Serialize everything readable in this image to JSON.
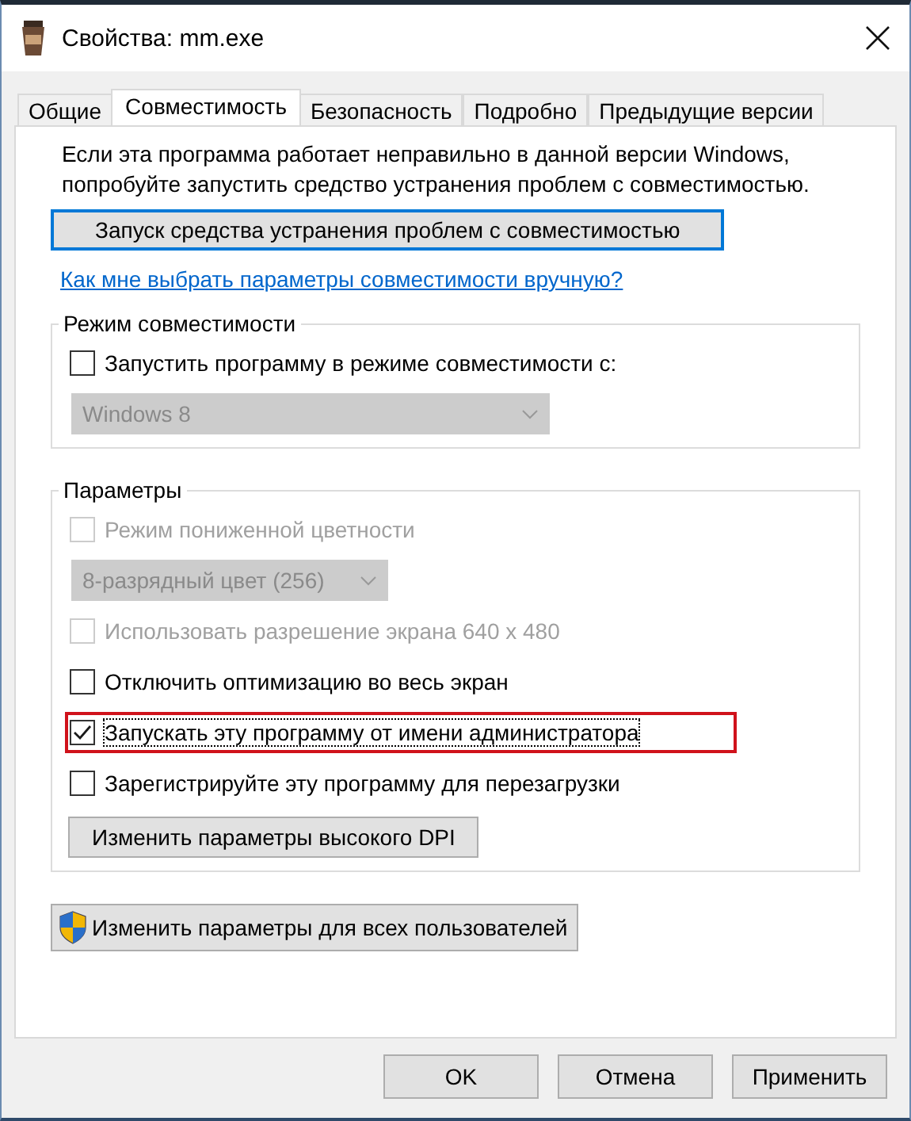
{
  "window": {
    "title": "Свойства: mm.exe"
  },
  "tabs": [
    {
      "label": "Общие",
      "selected": false
    },
    {
      "label": "Совместимость",
      "selected": true
    },
    {
      "label": "Безопасность",
      "selected": false
    },
    {
      "label": "Подробно",
      "selected": false
    },
    {
      "label": "Предыдущие версии",
      "selected": false
    }
  ],
  "intro": "Если эта программа работает неправильно в данной версии Windows, попробуйте запустить средство устранения проблем с совместимостью.",
  "troubleshoot_button": "Запуск средства устранения проблем с совместимостью",
  "help_link": "Как мне выбрать параметры совместимости вручную?",
  "groups": [
    {
      "title": "Режим совместимости",
      "items": [
        {
          "kind": "checkbox",
          "label": "Запустить программу в режиме совместимости с:",
          "checked": false,
          "disabled": false,
          "highlighted": false
        },
        {
          "kind": "dropdown",
          "value": "Windows 8",
          "disabled": true
        }
      ]
    },
    {
      "title": "Параметры",
      "items": [
        {
          "kind": "checkbox",
          "label": "Режим пониженной цветности",
          "checked": false,
          "disabled": true,
          "highlighted": false
        },
        {
          "kind": "dropdown",
          "value": "8-разрядный цвет (256)",
          "disabled": true
        },
        {
          "kind": "checkbox",
          "label": "Использовать разрешение экрана 640 x 480",
          "checked": false,
          "disabled": true,
          "highlighted": false
        },
        {
          "kind": "checkbox",
          "label": "Отключить оптимизацию во весь экран",
          "checked": false,
          "disabled": false,
          "highlighted": false
        },
        {
          "kind": "checkbox",
          "label": "Запускать эту программу от имени администратора",
          "checked": true,
          "disabled": false,
          "highlighted": true
        },
        {
          "kind": "checkbox",
          "label": "Зарегистрируйте эту программу для перезагрузки",
          "checked": false,
          "disabled": false,
          "highlighted": false
        },
        {
          "kind": "button",
          "label": "Изменить параметры высокого DPI"
        }
      ]
    }
  ],
  "all_users_button": "Изменить параметры для всех пользователей",
  "buttons": [
    "OK",
    "Отмена",
    "Применить"
  ]
}
